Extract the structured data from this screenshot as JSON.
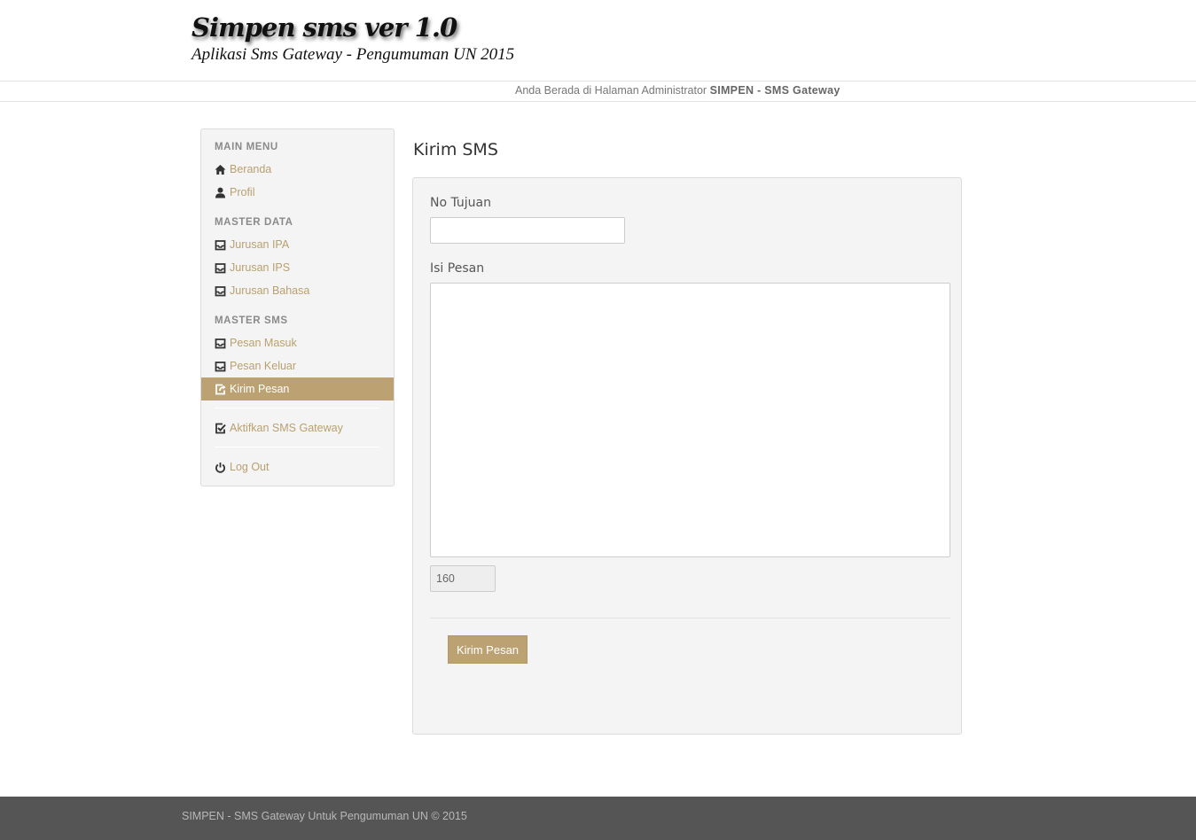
{
  "header": {
    "title": "Simpen sms ver 1.0",
    "subtitle": "Aplikasi Sms Gateway - Pengumuman UN 2015"
  },
  "infobar": {
    "prefix": "Anda Berada di Halaman Administrator ",
    "app_name": "SIMPEN - SMS Gateway"
  },
  "sidebar": {
    "sections": [
      {
        "header": "MAIN MENU"
      },
      {
        "header": "MASTER DATA"
      },
      {
        "header": "MASTER SMS"
      }
    ],
    "items": [
      {
        "label": "Beranda",
        "icon": "home-icon"
      },
      {
        "label": "Profil",
        "icon": "user-icon"
      },
      {
        "label": "Jurusan IPA",
        "icon": "inbox-icon"
      },
      {
        "label": "Jurusan IPS",
        "icon": "inbox-icon"
      },
      {
        "label": "Jurusan Bahasa",
        "icon": "inbox-icon"
      },
      {
        "label": "Pesan Masuk",
        "icon": "inbox-icon"
      },
      {
        "label": "Pesan Keluar",
        "icon": "inbox-icon"
      },
      {
        "label": "Kirim Pesan",
        "icon": "share-icon",
        "active": true
      },
      {
        "label": "Aktifkan SMS Gateway",
        "icon": "check-icon"
      },
      {
        "label": "Log Out",
        "icon": "power-icon"
      }
    ]
  },
  "main": {
    "title": "Kirim SMS",
    "form": {
      "no_tujuan_label": "No Tujuan",
      "no_tujuan_value": "",
      "isi_pesan_label": "Isi Pesan",
      "isi_pesan_value": "",
      "counter_value": "160",
      "submit_label": "Kirim Pesan"
    }
  },
  "footer": {
    "text": "SIMPEN - SMS Gateway Untuk Pengumuman UN © 2015"
  },
  "colors": {
    "accent": "#bca272",
    "link": "#b9a06f",
    "footer_bg": "#555555"
  }
}
